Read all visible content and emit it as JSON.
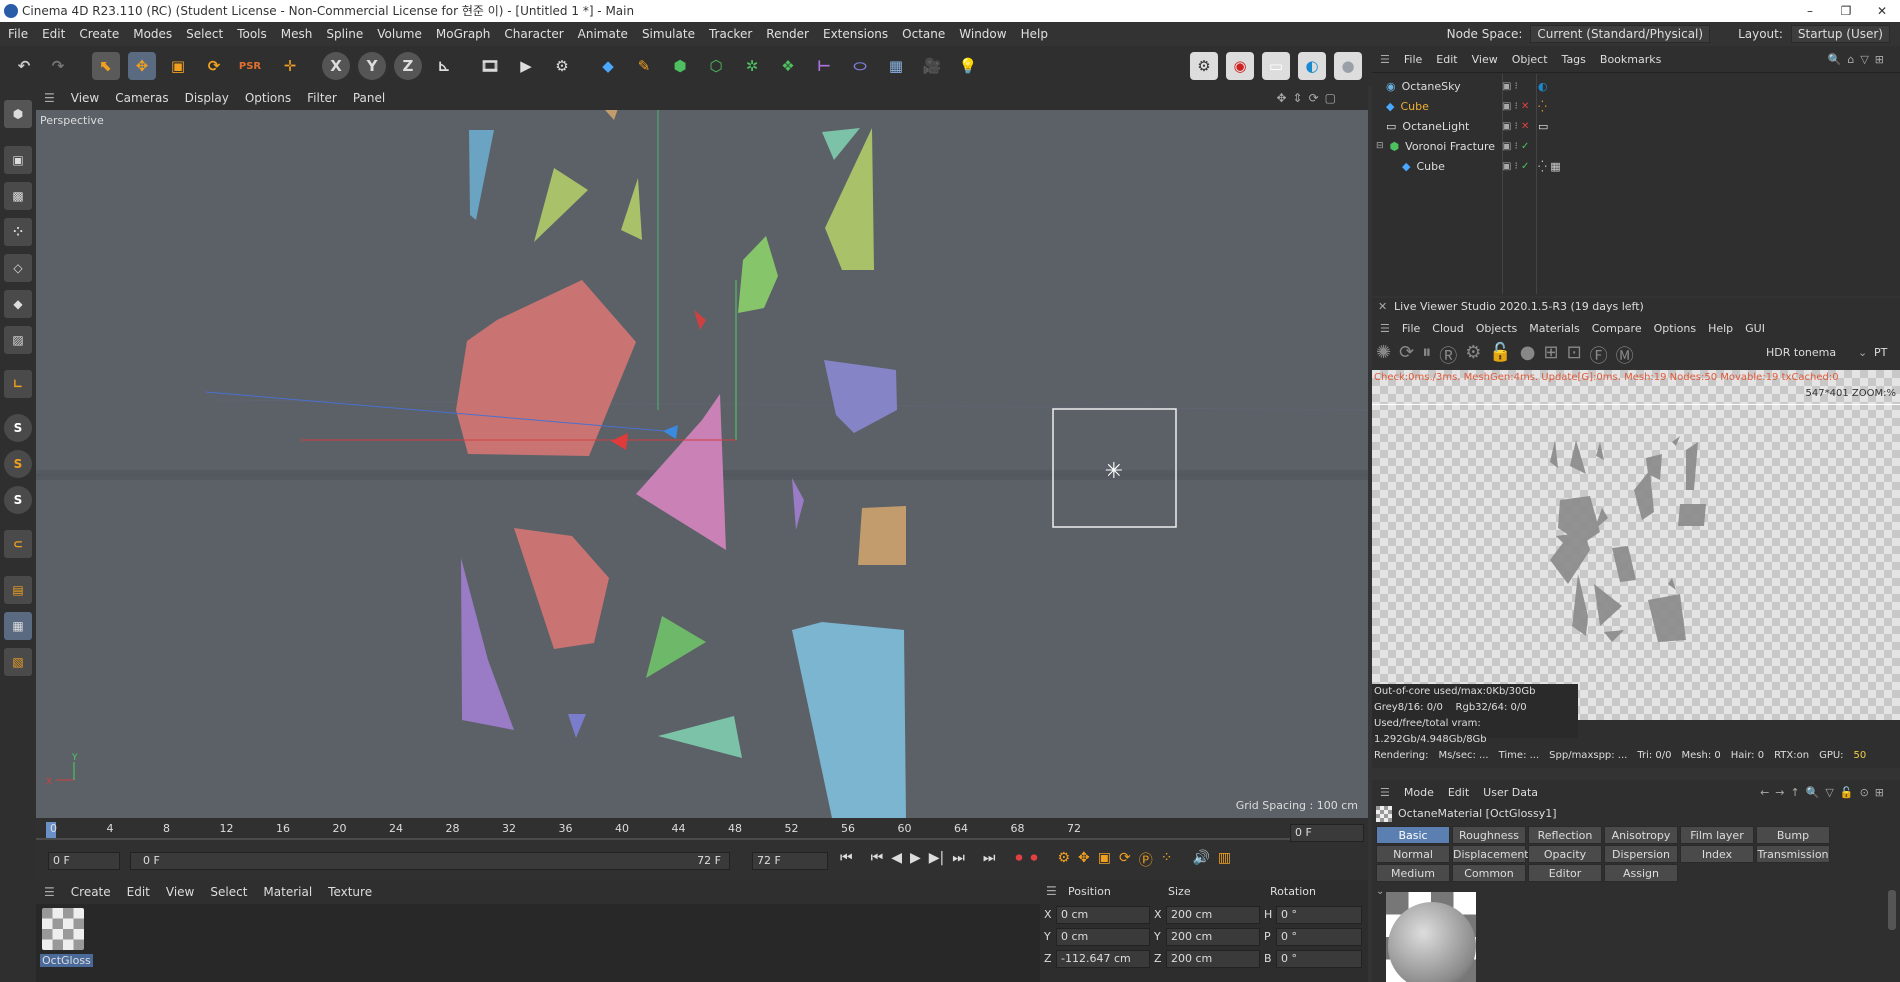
{
  "window": {
    "title": "Cinema 4D R23.110 (RC) (Student License - Non-Commercial License for 현준 이) - [Untitled 1 *] - Main"
  },
  "menu": [
    "File",
    "Edit",
    "Create",
    "Modes",
    "Select",
    "Tools",
    "Mesh",
    "Spline",
    "Volume",
    "MoGraph",
    "Character",
    "Animate",
    "Simulate",
    "Tracker",
    "Render",
    "Extensions",
    "Octane",
    "Window",
    "Help"
  ],
  "nodespace": {
    "label": "Node Space:",
    "value": "Current (Standard/Physical)",
    "layout_label": "Layout:",
    "layout_value": "Startup (User)"
  },
  "viewport": {
    "menu": [
      "View",
      "Cameras",
      "Display",
      "Options",
      "Filter",
      "Panel"
    ],
    "name": "Perspective",
    "grid_spacing": "Grid Spacing : 100 cm"
  },
  "timeline": {
    "ticks": [
      "0",
      "4",
      "8",
      "12",
      "16",
      "20",
      "24",
      "28",
      "32",
      "36",
      "40",
      "44",
      "48",
      "52",
      "56",
      "60",
      "64",
      "68",
      "72"
    ],
    "current_frame": "0 F",
    "start": "0 F",
    "range_start": "0 F",
    "range_end": "72 F",
    "end": "72 F"
  },
  "material_manager": {
    "menu": [
      "Create",
      "Edit",
      "View",
      "Select",
      "Material",
      "Texture"
    ],
    "material_name": "OctGloss"
  },
  "coordinates": {
    "headers": [
      "Position",
      "Size",
      "Rotation"
    ],
    "rows": [
      {
        "axis": "X",
        "pos": "0 cm",
        "size_axis": "X",
        "size": "200 cm",
        "rot_axis": "H",
        "rot": "0 °"
      },
      {
        "axis": "Y",
        "pos": "0 cm",
        "size_axis": "Y",
        "size": "200 cm",
        "rot_axis": "P",
        "rot": "0 °"
      },
      {
        "axis": "Z",
        "pos": "-112.647 cm",
        "size_axis": "Z",
        "size": "200 cm",
        "rot_axis": "B",
        "rot": "0 °"
      }
    ]
  },
  "object_manager": {
    "menu": [
      "File",
      "Edit",
      "View",
      "Object",
      "Tags",
      "Bookmarks"
    ],
    "objects": [
      {
        "name": "OctaneSky",
        "color": "#dddddd"
      },
      {
        "name": "Cube",
        "color": "#f0b030"
      },
      {
        "name": "OctaneLight",
        "color": "#dddddd"
      },
      {
        "name": "Voronoi Fracture",
        "color": "#dddddd"
      },
      {
        "name": "Cube",
        "color": "#dddddd"
      }
    ]
  },
  "live_viewer": {
    "title": "Live Viewer Studio 2020.1.5-R3 (19 days left)",
    "menu": [
      "File",
      "Cloud",
      "Objects",
      "Materials",
      "Compare",
      "Options",
      "Help",
      "GUI"
    ],
    "tonemap": "HDR tonema",
    "mode": "PT",
    "stats_line": "Check:0ms./3ms. MeshGen:4ms. Update[G]:0ms. Mesh:19 Nodes:50 Movable:19 txCached:0",
    "resolution": "547*401 ZOOM:%",
    "ooc": "Out-of-core used/max:0Kb/30Gb",
    "grey": "Grey8/16: 0/0",
    "rgb": "Rgb32/64: 0/0",
    "vram": "Used/free/total vram: 1.292Gb/4.948Gb/8Gb",
    "rendering": "Rendering:",
    "ms": "Ms/sec: ...",
    "time": "Time: ...",
    "spp": "Spp/maxspp: ...",
    "tri": "Tri: 0/0",
    "mesh": "Mesh: 0",
    "hair": "Hair: 0",
    "rtx": "RTX:on",
    "gpu": "GPU:",
    "gpu_val": "50"
  },
  "attributes": {
    "menu": [
      "Mode",
      "Edit",
      "User Data"
    ],
    "material_title": "OctaneMaterial [OctGlossy1]",
    "tabs_row1": [
      "Basic",
      "Roughness",
      "Reflection",
      "Anisotropy",
      "Film layer",
      "Bump"
    ],
    "tabs_row2": [
      "Normal",
      "Displacement",
      "Opacity",
      "Dispersion",
      "Index",
      "Transmission"
    ],
    "tabs_row3": [
      "Medium",
      "Common",
      "Editor",
      "Assign"
    ]
  }
}
